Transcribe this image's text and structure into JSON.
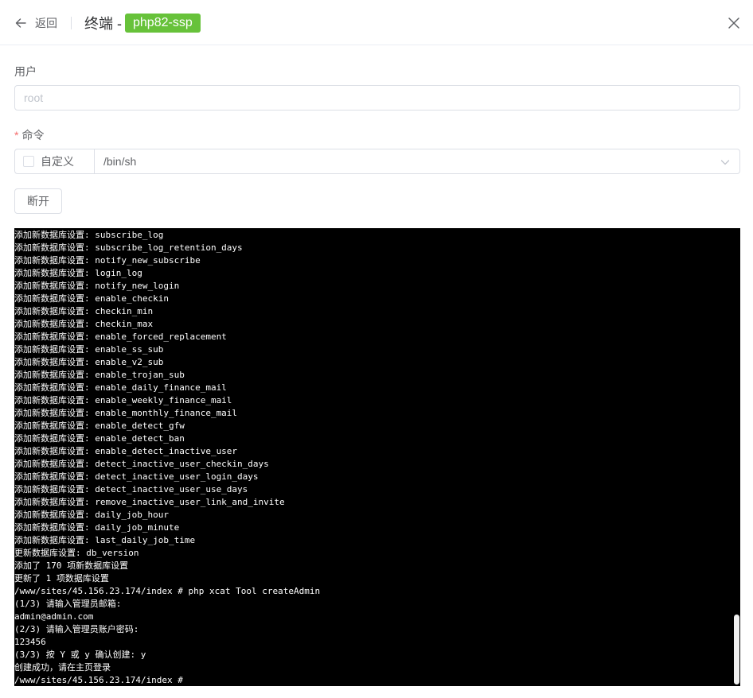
{
  "header": {
    "back_label": "返回",
    "title_prefix": "终端 -",
    "title_tag": "php82-ssp",
    "tag_color": "#67c23a"
  },
  "form": {
    "user_label": "用户",
    "user_placeholder": "root",
    "command_required_mark": "*",
    "command_label": "命令",
    "custom_label": "自定义",
    "custom_checked": false,
    "command_value": "/bin/sh",
    "disconnect_label": "断开"
  },
  "terminal": {
    "background": "#000000",
    "foreground": "#ffffff",
    "lines": [
      "添加新数据库设置: subscribe_log",
      "添加新数据库设置: subscribe_log_retention_days",
      "添加新数据库设置: notify_new_subscribe",
      "添加新数据库设置: login_log",
      "添加新数据库设置: notify_new_login",
      "添加新数据库设置: enable_checkin",
      "添加新数据库设置: checkin_min",
      "添加新数据库设置: checkin_max",
      "添加新数据库设置: enable_forced_replacement",
      "添加新数据库设置: enable_ss_sub",
      "添加新数据库设置: enable_v2_sub",
      "添加新数据库设置: enable_trojan_sub",
      "添加新数据库设置: enable_daily_finance_mail",
      "添加新数据库设置: enable_weekly_finance_mail",
      "添加新数据库设置: enable_monthly_finance_mail",
      "添加新数据库设置: enable_detect_gfw",
      "添加新数据库设置: enable_detect_ban",
      "添加新数据库设置: enable_detect_inactive_user",
      "添加新数据库设置: detect_inactive_user_checkin_days",
      "添加新数据库设置: detect_inactive_user_login_days",
      "添加新数据库设置: detect_inactive_user_use_days",
      "添加新数据库设置: remove_inactive_user_link_and_invite",
      "添加新数据库设置: daily_job_hour",
      "添加新数据库设置: daily_job_minute",
      "添加新数据库设置: last_daily_job_time",
      "更新数据库设置: db_version",
      "添加了 170 项新数据库设置",
      "更新了 1 项数据库设置",
      "/www/sites/45.156.23.174/index # php xcat Tool createAdmin",
      "(1/3) 请输入管理员邮箱:",
      "admin@admin.com",
      "(2/3) 请输入管理员账户密码:",
      "123456",
      "(3/3) 按 Y 或 y 确认创建: y",
      "创建成功，请在主页登录",
      "/www/sites/45.156.23.174/index # "
    ]
  }
}
